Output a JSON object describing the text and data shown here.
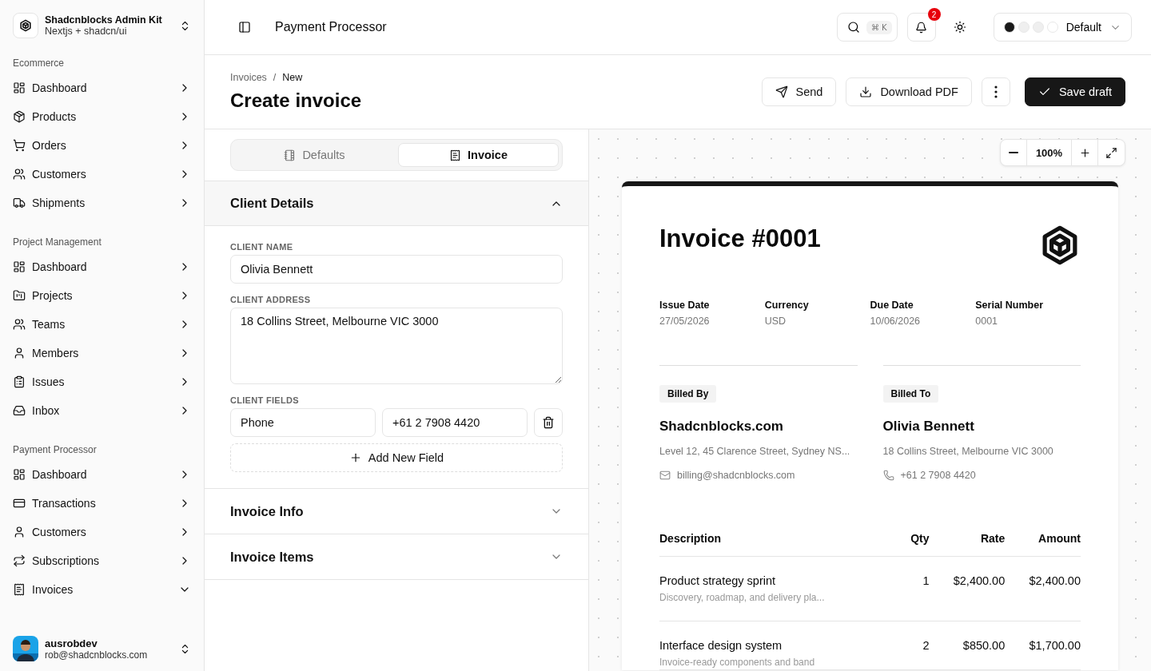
{
  "brand": {
    "name": "Shadcnblocks Admin Kit",
    "subtitle": "Nextjs + shadcn/ui"
  },
  "sidebar": {
    "groups": [
      {
        "label": "Ecommerce",
        "items": [
          {
            "label": "Dashboard",
            "expanded": false
          },
          {
            "label": "Products",
            "expanded": false
          },
          {
            "label": "Orders",
            "expanded": false
          },
          {
            "label": "Customers",
            "expanded": false
          },
          {
            "label": "Shipments",
            "expanded": false
          }
        ]
      },
      {
        "label": "Project Management",
        "items": [
          {
            "label": "Dashboard",
            "expanded": false
          },
          {
            "label": "Projects",
            "expanded": false
          },
          {
            "label": "Teams",
            "expanded": false
          },
          {
            "label": "Members",
            "expanded": false
          },
          {
            "label": "Issues",
            "expanded": false
          },
          {
            "label": "Inbox",
            "expanded": false
          }
        ]
      },
      {
        "label": "Payment Processor",
        "items": [
          {
            "label": "Dashboard",
            "expanded": false
          },
          {
            "label": "Transactions",
            "expanded": false
          },
          {
            "label": "Customers",
            "expanded": false
          },
          {
            "label": "Subscriptions",
            "expanded": false
          },
          {
            "label": "Invoices",
            "expanded": true
          }
        ]
      }
    ]
  },
  "user": {
    "name": "ausrobdev",
    "email": "rob@shadcnblocks.com"
  },
  "topbar": {
    "title": "Payment Processor",
    "shortcut": "⌘ K",
    "notifications": "2",
    "theme": {
      "label": "Default",
      "swatches": [
        {
          "color": "#1a1a1a"
        },
        {
          "color": "#efefef"
        },
        {
          "color": "#efefef"
        },
        {
          "color": "#ffffff"
        }
      ]
    }
  },
  "breadcrumb": [
    "Invoices",
    "New"
  ],
  "breadcrumb_separator": "/",
  "page_title": "Create invoice",
  "actions": [
    {
      "kind": "send",
      "label": "Send"
    },
    {
      "kind": "download",
      "label": "Download PDF"
    },
    {
      "kind": "more"
    },
    {
      "kind": "primary",
      "label": "Save draft"
    }
  ],
  "editor_tabs": [
    {
      "label": "Defaults",
      "selected": false
    },
    {
      "label": "Invoice",
      "selected": true
    }
  ],
  "sections": [
    {
      "title": "Client Details",
      "expanded": true,
      "form": {
        "name_label": "CLIENT NAME",
        "name": "Olivia Bennett",
        "address_label": "CLIENT ADDRESS",
        "address": "18 Collins Street, Melbourne VIC 3000",
        "fields_label": "CLIENT FIELDS",
        "fields": [
          {
            "key": "Phone",
            "value": "+61 2 7908 4420"
          }
        ],
        "add_button": "Add New Field"
      }
    },
    {
      "title": "Invoice Info",
      "expanded": false
    },
    {
      "title": "Invoice Items",
      "expanded": false
    }
  ],
  "zoom": {
    "value": "100%"
  },
  "invoice": {
    "title": "Invoice #0001",
    "meta": [
      {
        "label": "Issue Date",
        "value": "27/05/2026"
      },
      {
        "label": "Currency",
        "value": "USD"
      },
      {
        "label": "Due Date",
        "value": "10/06/2026"
      },
      {
        "label": "Serial Number",
        "value": "0001"
      }
    ],
    "parties": [
      {
        "tag": "Billed By",
        "name": "Shadcnblocks.com",
        "address": "Level 12, 45 Clarence Street, Sydney NS...",
        "kind": "email",
        "contact": "billing@shadcnblocks.com"
      },
      {
        "tag": "Billed To",
        "name": "Olivia Bennett",
        "address": "18 Collins Street, Melbourne VIC 3000",
        "kind": "phone",
        "contact": "+61 2 7908 4420"
      }
    ],
    "table": {
      "columns": [
        "Description",
        "Qty",
        "Rate",
        "Amount"
      ],
      "rows": [
        {
          "description": "Product strategy sprint",
          "note": "Discovery, roadmap, and delivery pla...",
          "qty": "1",
          "rate": "$2,400.00",
          "amount": "$2,400.00"
        },
        {
          "description": "Interface design system",
          "note": "Invoice-ready components and band",
          "qty": "2",
          "rate": "$850.00",
          "amount": "$1,700.00"
        }
      ]
    }
  }
}
